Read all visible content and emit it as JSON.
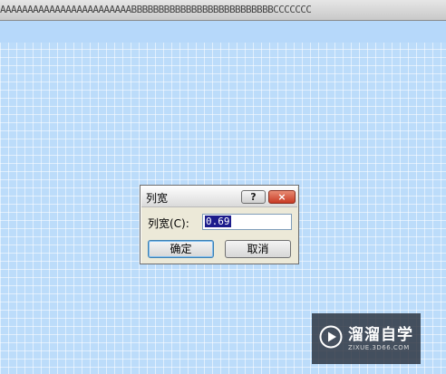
{
  "sheet": {
    "column_header_text": "AAAAAAAAAAAAAAAAAAAAAAAABBBBBBBBBBBBBBBBBBBBBBBBBBCCCCCCC"
  },
  "dialog": {
    "title": "列宽",
    "help_label": "?",
    "close_label": "×",
    "field_label": "列宽(C):",
    "field_value": "0.69",
    "ok_label": "确定",
    "cancel_label": "取消"
  },
  "watermark": {
    "brand": "溜溜自学",
    "url": "ZIXUE.3D66.COM"
  },
  "colors": {
    "sheet_background": "#bcdcfa",
    "dialog_background": "#ece9d8",
    "selection": "#1c1c8c"
  }
}
